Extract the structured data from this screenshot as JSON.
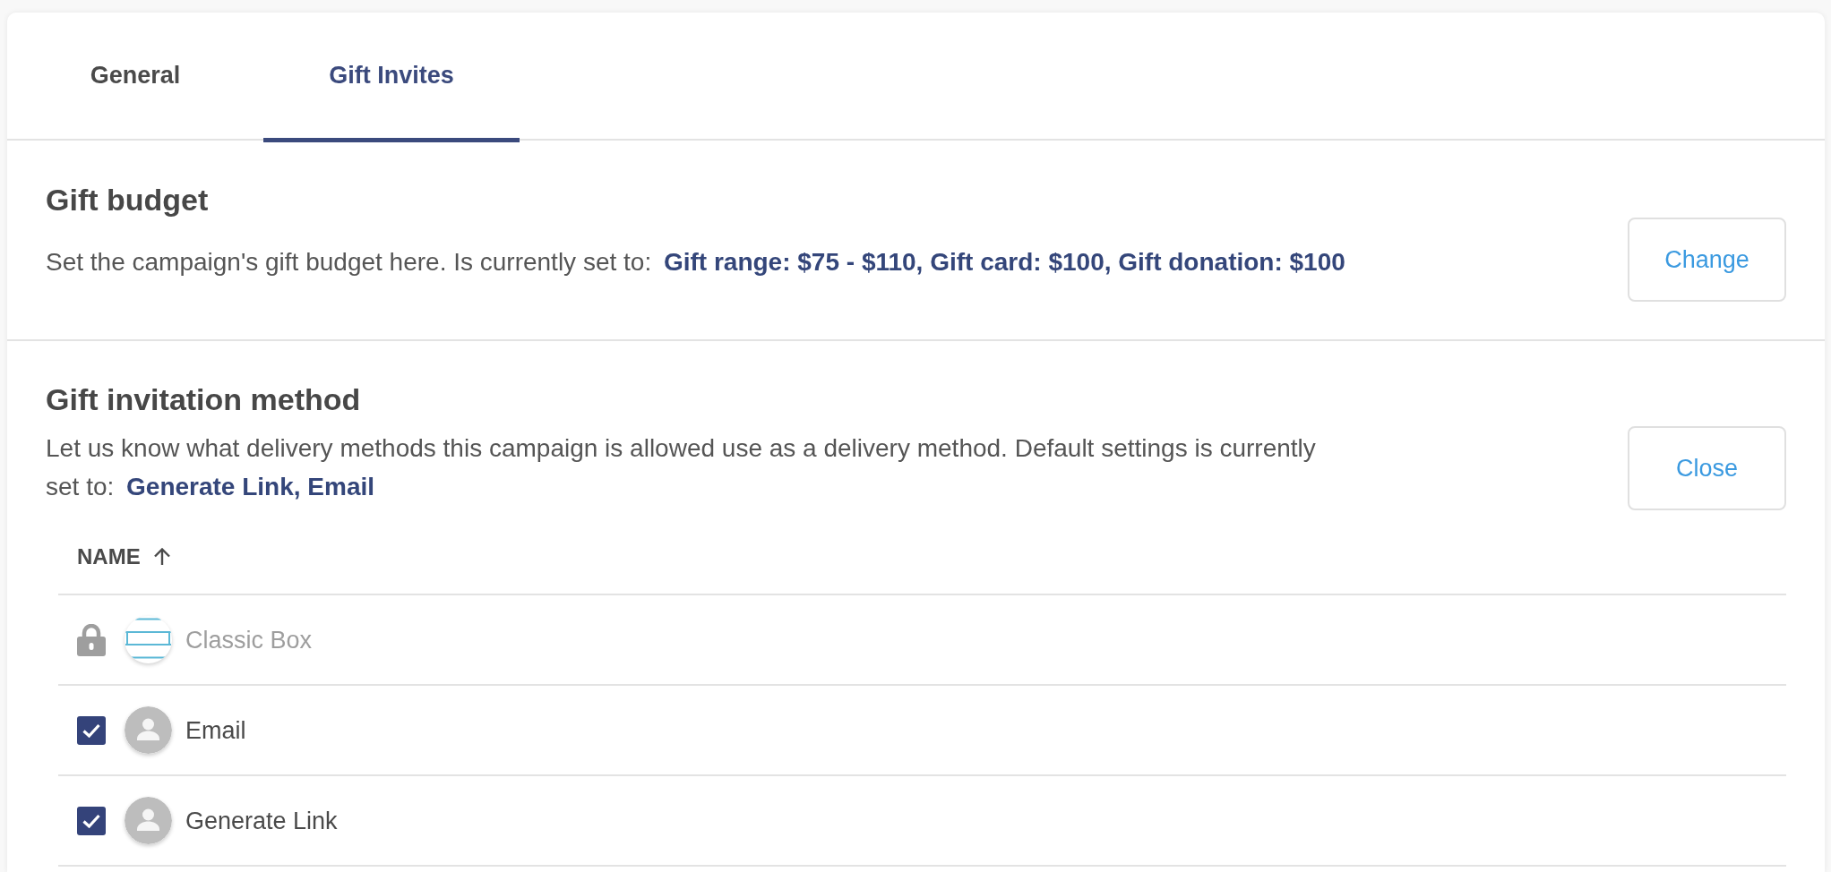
{
  "tabs": [
    {
      "label": "General",
      "selected": false
    },
    {
      "label": "Gift Invites",
      "selected": true
    }
  ],
  "gift_budget": {
    "title": "Gift budget",
    "description": "Set the campaign's gift budget here. Is currently set to: **Gift range: $75 - $110, Gift card: $100, Gift donation: $100**",
    "button": "Change"
  },
  "invitation_method": {
    "title": "Gift invitation method",
    "description": "Let us know what delivery methods this campaign is allowed use as a delivery method. Default settings is currently set to: **Generate Link, Email**",
    "button": "Close",
    "table": {
      "columns": [
        {
          "label": "NAME",
          "sorted": true
        }
      ],
      "rows": [
        {
          "name": "Classic Box",
          "kind": "locked"
        },
        {
          "name": "Email",
          "kind": "checkbox",
          "checked": true
        },
        {
          "name": "Generate Link",
          "kind": "checkbox",
          "checked": true
        }
      ]
    }
  }
}
